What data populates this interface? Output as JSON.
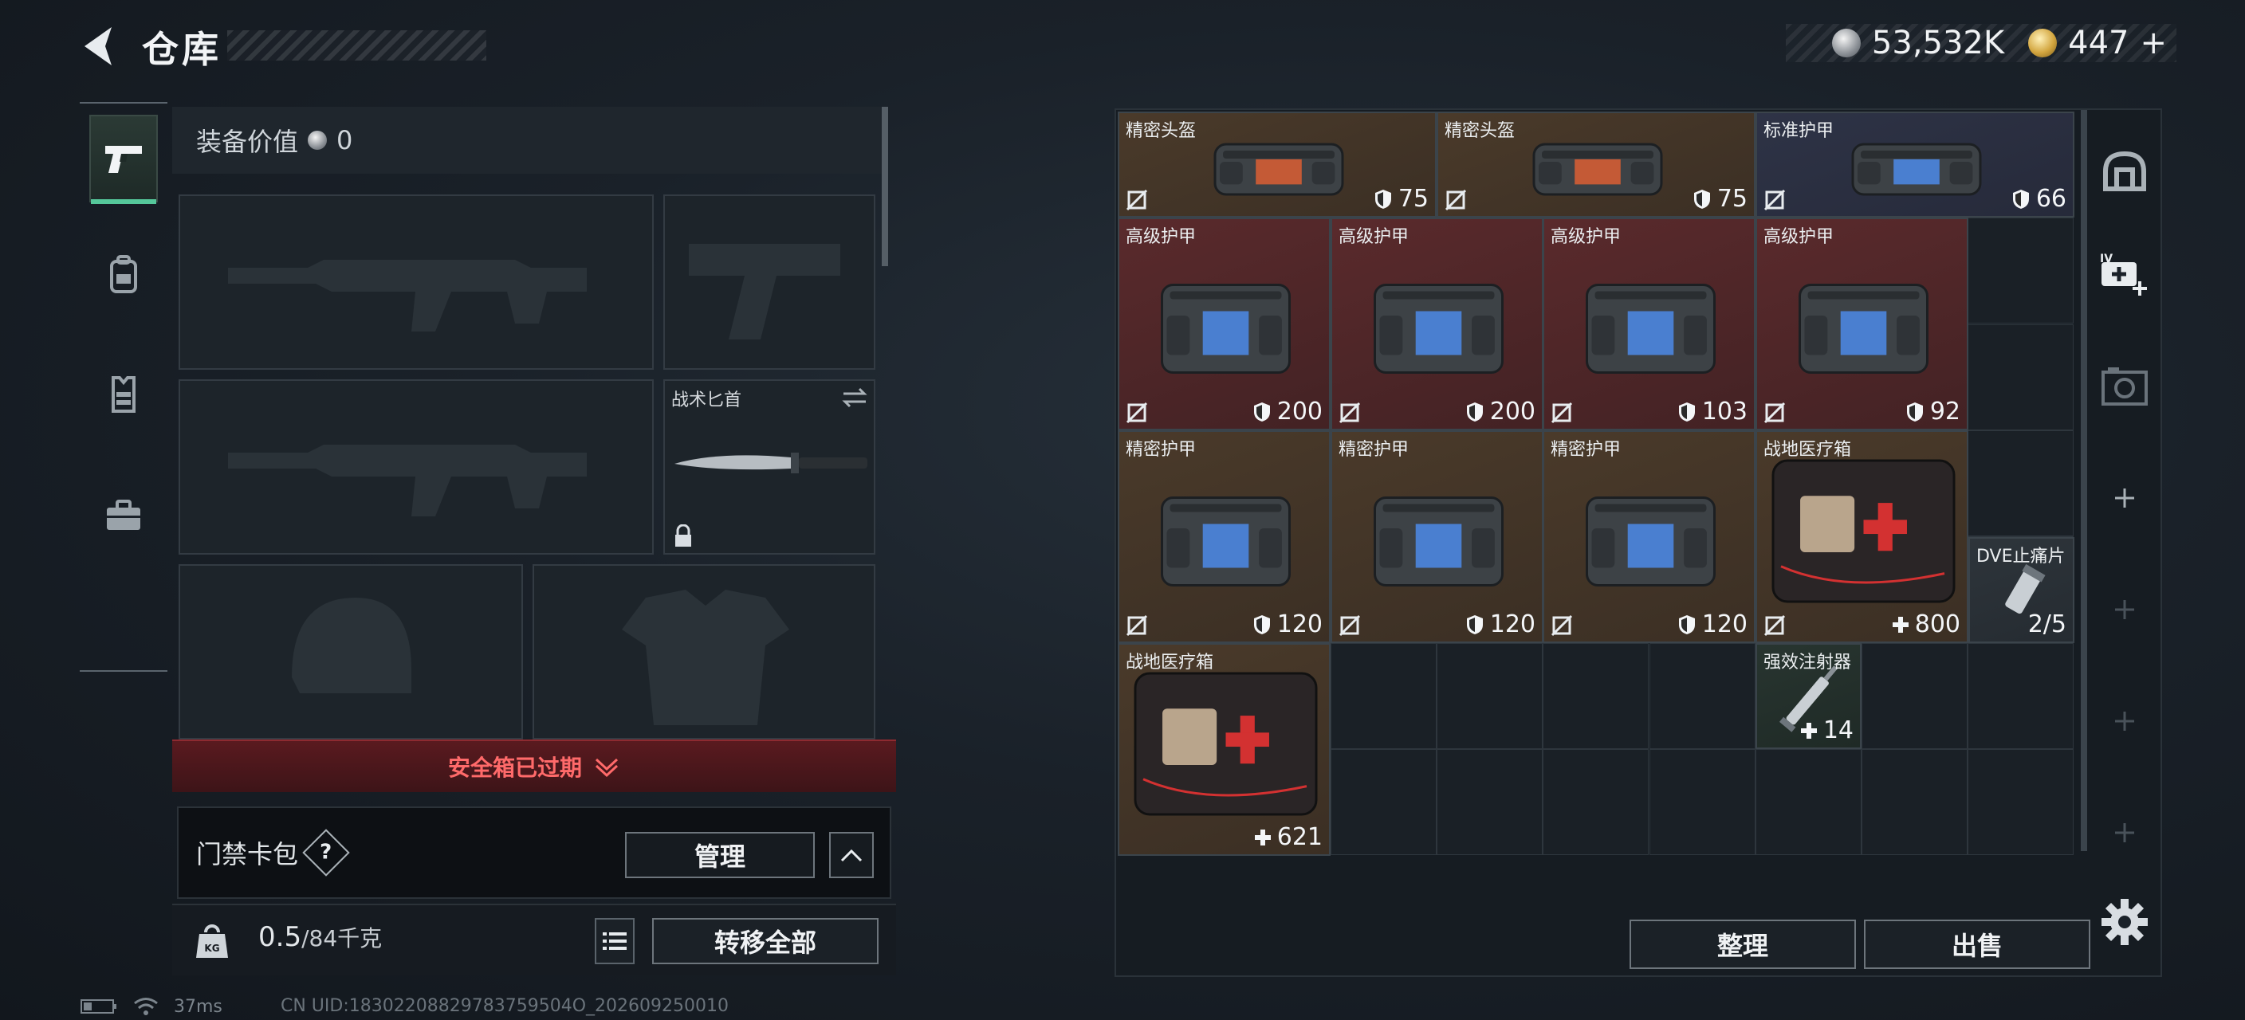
{
  "header": {
    "title": "仓库"
  },
  "currency": {
    "silver": "53,532K",
    "gold": "447",
    "gold_plus": "+"
  },
  "equipment": {
    "value_label": "装备价值",
    "value": "0",
    "melee_label": "战术匕首",
    "alert": "安全箱已过期",
    "keycard_label": "门禁卡包",
    "help": "?",
    "manage": "管理",
    "weight_value": "0.5",
    "weight_max": "/84千克",
    "transfer_all": "转移全部"
  },
  "storage": {
    "items": [
      {
        "name": "精密头盔",
        "value": "75",
        "stat": "armor",
        "color": "brown"
      },
      {
        "name": "精密头盔",
        "value": "75",
        "stat": "armor",
        "color": "brown"
      },
      {
        "name": "标准护甲",
        "value": "66",
        "stat": "armor",
        "color": "blue"
      },
      {
        "name": "高级护甲",
        "value": "200",
        "stat": "armor",
        "color": "red"
      },
      {
        "name": "高级护甲",
        "value": "200",
        "stat": "armor",
        "color": "red"
      },
      {
        "name": "高级护甲",
        "value": "103",
        "stat": "armor",
        "color": "red"
      },
      {
        "name": "高级护甲",
        "value": "92",
        "stat": "armor",
        "color": "red"
      },
      {
        "name": "精密护甲",
        "value": "120",
        "stat": "armor",
        "color": "brown"
      },
      {
        "name": "精密护甲",
        "value": "120",
        "stat": "armor",
        "color": "brown"
      },
      {
        "name": "精密护甲",
        "value": "120",
        "stat": "armor",
        "color": "brown"
      },
      {
        "name": "战地医疗箱",
        "value": "800",
        "stat": "heal",
        "color": "brown"
      },
      {
        "name": "DVE止痛片",
        "value": "2/5",
        "stat": "count",
        "color": "gray"
      },
      {
        "name": "战地医疗箱",
        "value": "621",
        "stat": "heal",
        "color": "brown"
      },
      {
        "name": "强效注射器",
        "value": "14",
        "stat": "heal",
        "color": "green"
      }
    ],
    "sort": "整理",
    "sell": "出售"
  },
  "status": {
    "ping": "37ms",
    "uid": "CN UID:18302208829783759504O_202609250010"
  },
  "icons": {
    "back": "back-arrow-icon",
    "tabs": [
      "pistol-icon",
      "backpack-icon",
      "vest-icon",
      "briefcase-icon"
    ],
    "toolbar": [
      "helmet-icon",
      "add-medkit-icon",
      "photo-icon",
      "plus-icon"
    ]
  }
}
